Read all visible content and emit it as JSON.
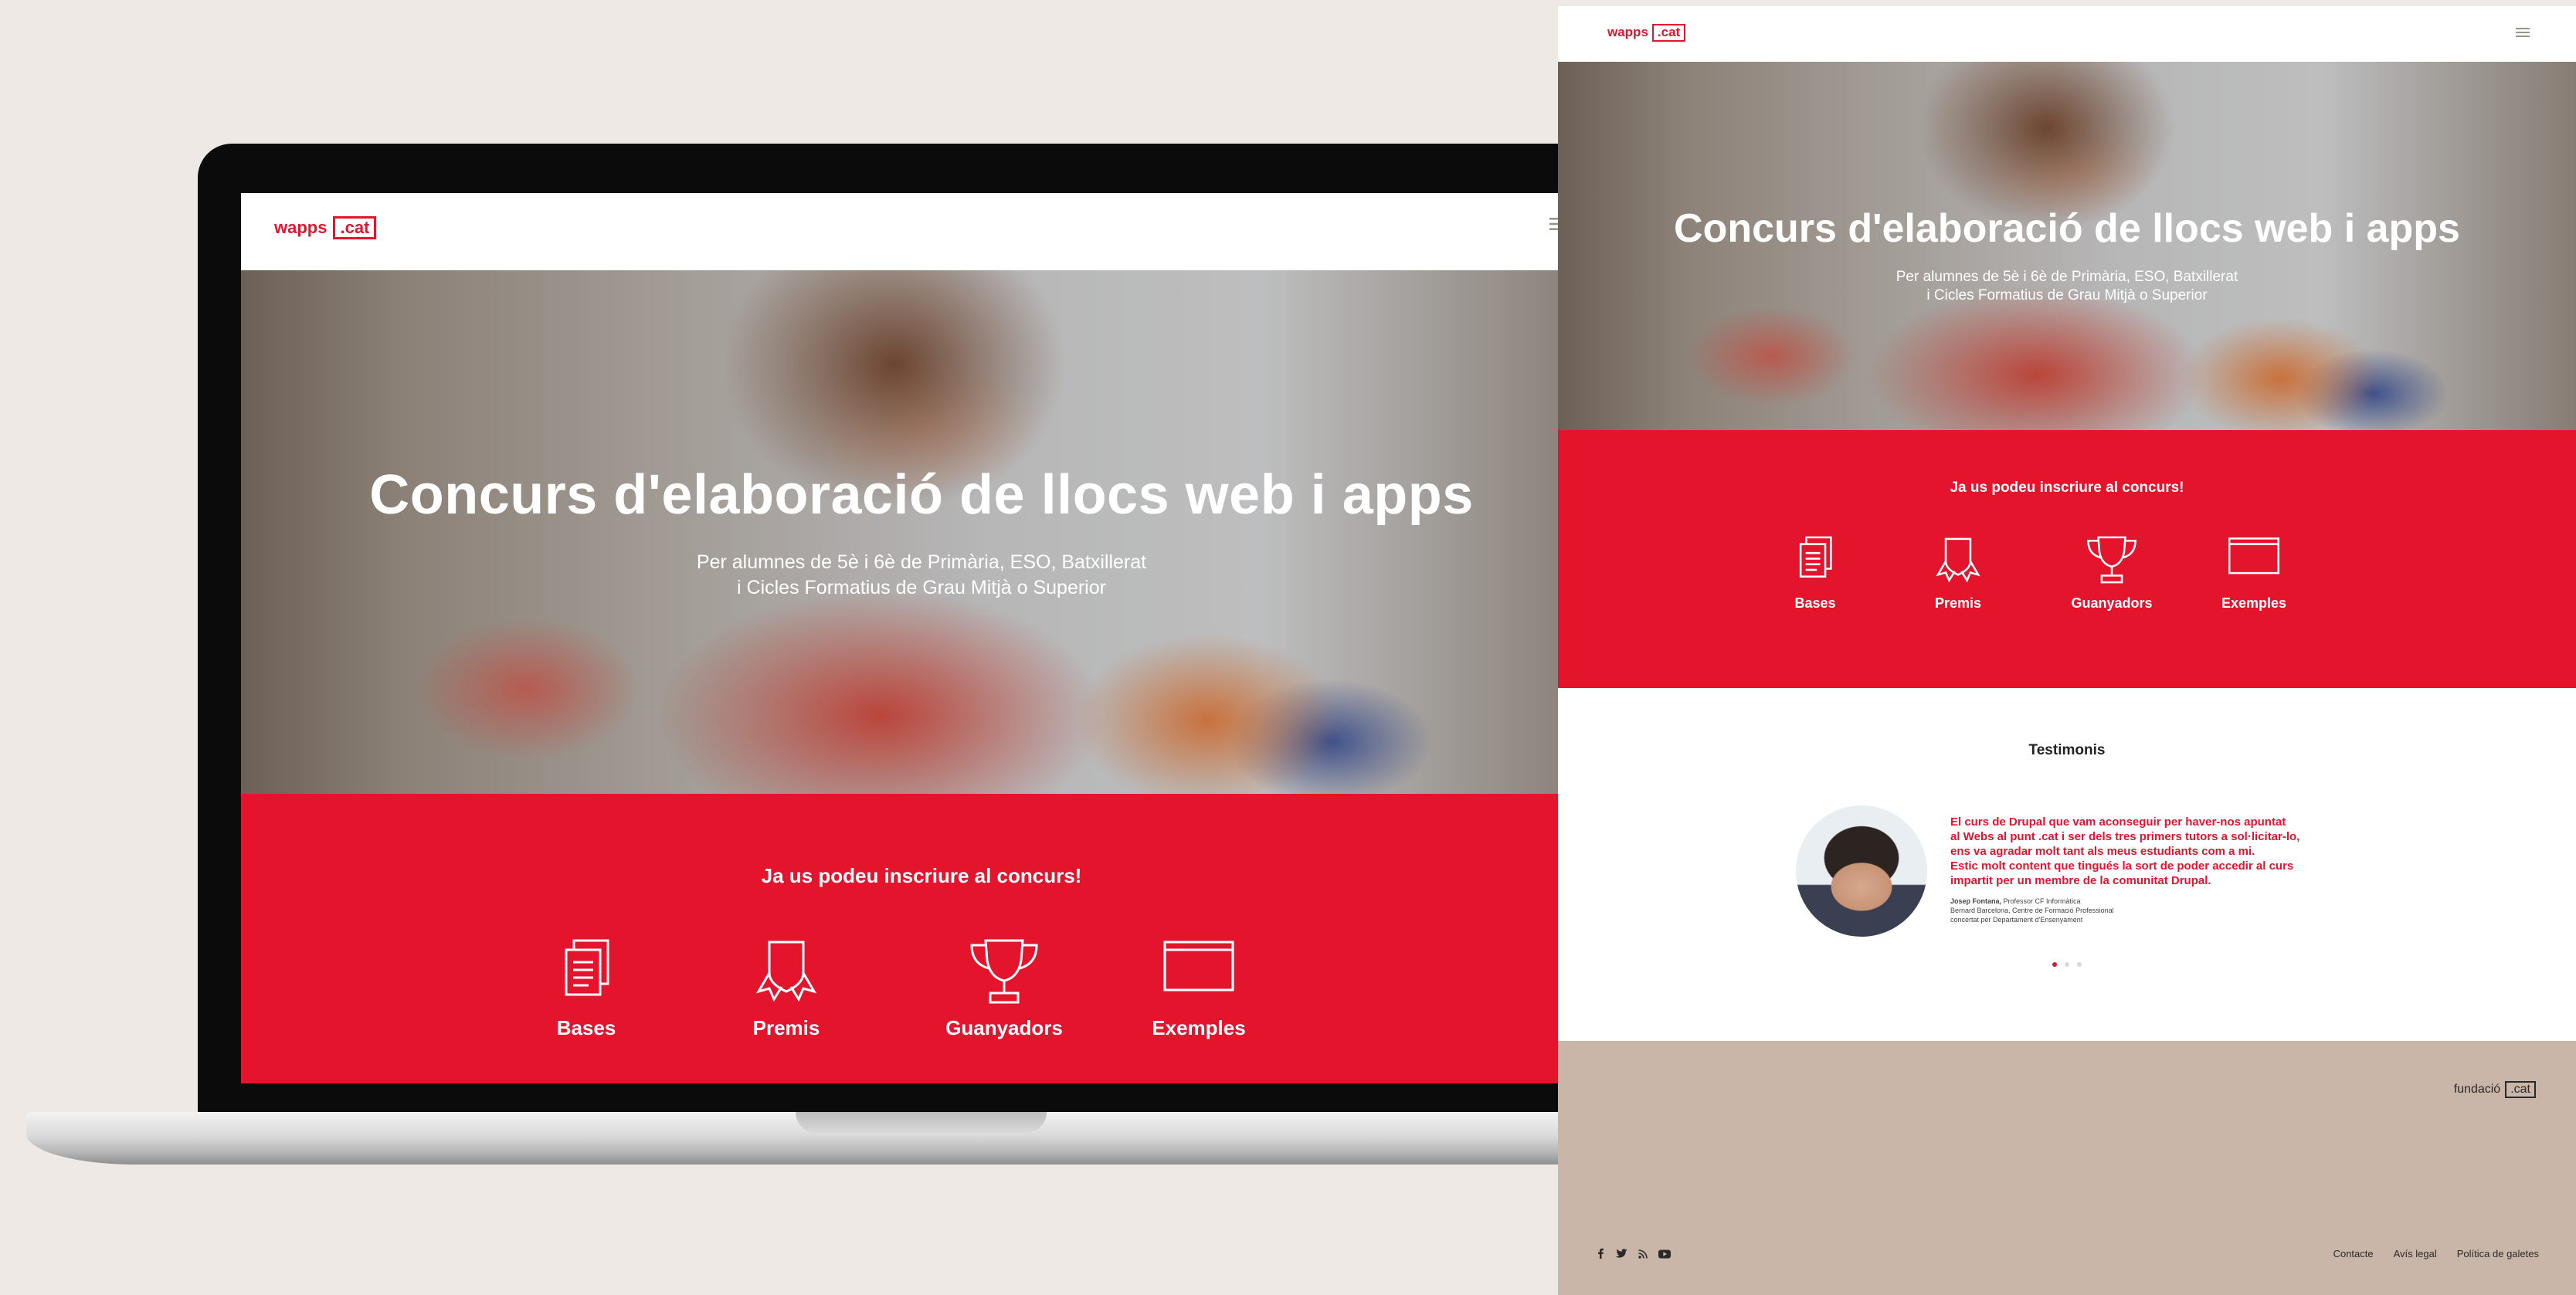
{
  "site": {
    "logo_text": "wapps",
    "logo_box": ".cat",
    "menu_icon": "hamburger-icon"
  },
  "hero": {
    "title": "Concurs d'elaboració de llocs web i apps",
    "subtitle_line1": "Per alumnes de 5è i 6è de Primària, ESO, Batxillerat",
    "subtitle_line2": "i Cicles Formatius de Grau Mitjà o Superior"
  },
  "signup": {
    "heading": "Ja us podeu inscriure al concurs!",
    "items": [
      {
        "label": "Bases",
        "icon": "document-icon"
      },
      {
        "label": "Premis",
        "icon": "badge-icon"
      },
      {
        "label": "Guanyadors",
        "icon": "trophy-icon"
      },
      {
        "label": "Exemples",
        "icon": "browser-window-icon"
      }
    ]
  },
  "testimonials": {
    "heading": "Testimonis",
    "quote_line1": "El curs de Drupal que vam aconseguir per haver-nos apuntat",
    "quote_line2": "al Webs al punt .cat i ser dels tres primers tutors a sol·licitar-lo,",
    "quote_line3": "ens va agradar molt tant als meus estudiants com a mi.",
    "quote_line4": "Estic molt content que tingués la sort de poder accedir al curs",
    "quote_line5": "impartit per un membre de la comunitat Drupal.",
    "author_name": "Josep Fontana,",
    "author_role": " Professor CF Informàtica",
    "author_line2": "Bernard Barcelona, Centre de Formació Professional",
    "author_line3": "concertat per Departament d'Ensenyament"
  },
  "footer": {
    "org_text": "fundació",
    "org_box": ".cat",
    "social_icons": [
      "facebook-icon",
      "twitter-icon",
      "rss-icon",
      "youtube-icon"
    ],
    "links": [
      "Contacte",
      "Avís legal",
      "Política de galetes"
    ]
  },
  "colors": {
    "accent": "#e4142d",
    "footer_bg": "#c9b6a9",
    "page_bg": "#efe9e6"
  }
}
